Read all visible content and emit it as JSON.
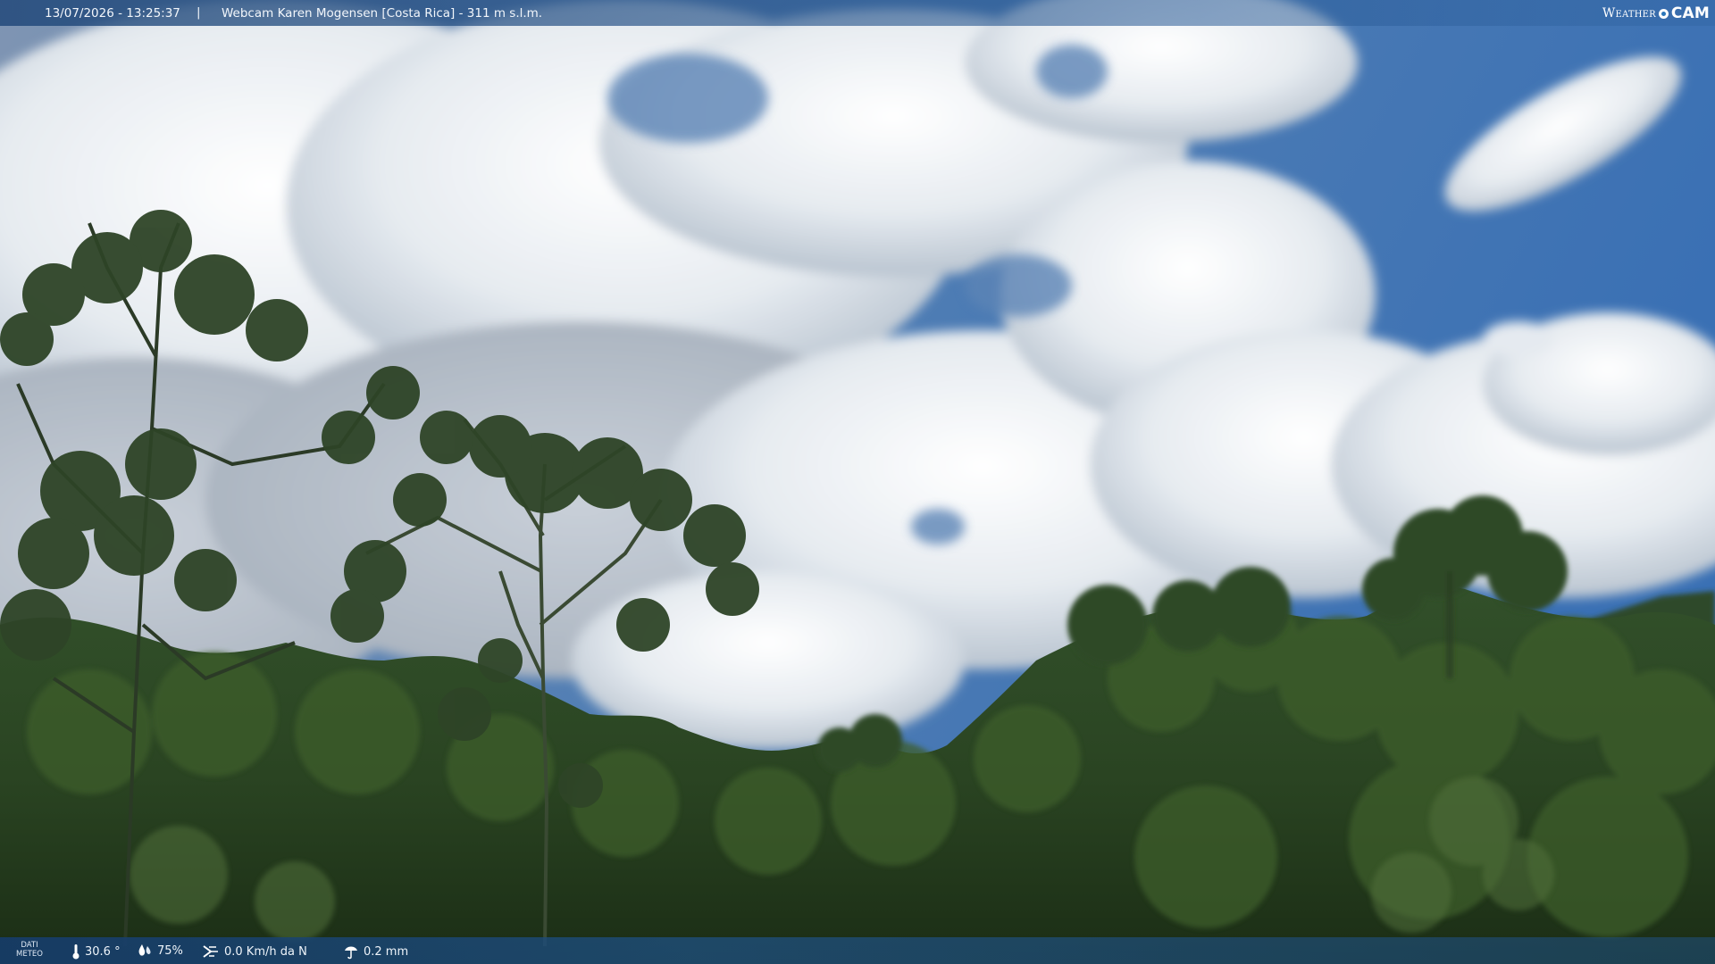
{
  "overlay": {
    "timestamp": "13/07/2026 - 13:25:37",
    "separator": "|",
    "title": "Webcam Karen Mogensen [Costa Rica]  - 311 m s.l.m.",
    "logo_text_1": "Weather",
    "logo_text_2": "CAM"
  },
  "meteo": {
    "label_line1": "DATI",
    "label_line2": "METEO",
    "temperature": "30.6 °",
    "humidity": "75%",
    "wind": "0.0 Km/h da N",
    "rain": "0.2 mm"
  },
  "colors": {
    "sky_blue": "#3f76b8",
    "cloud": "#e9eef3",
    "forest_dark": "#1e3318",
    "forest_mid": "#3d5a2a",
    "bar": "#1e4a80"
  },
  "icons": [
    "thermometer-icon",
    "humidity-drop-icon",
    "wind-icon",
    "rain-icon"
  ]
}
